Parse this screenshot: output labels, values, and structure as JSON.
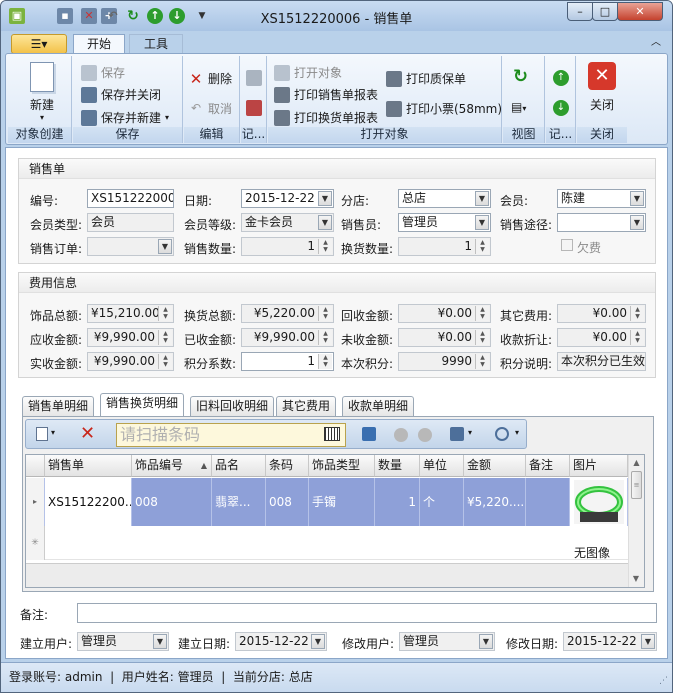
{
  "window": {
    "title": "XS1512220006 - 销售单",
    "minimize": "–",
    "maximize": "□",
    "close": "✕"
  },
  "ribbon": {
    "tabs": [
      "开始",
      "工具"
    ],
    "groups": {
      "object_create": {
        "label": "对象创建",
        "new": "新建"
      },
      "save": {
        "label": "保存",
        "save": "保存",
        "save_close": "保存并关闭",
        "save_new": "保存并新建"
      },
      "edit": {
        "label": "编辑",
        "delete": "删除",
        "cancel": "取消"
      },
      "record": {
        "label": "记..."
      },
      "open": {
        "label": "打开对象",
        "open_object": "打开对象",
        "print_sales_report": "打印销售单报表",
        "print_exchange_report": "打印换货单报表",
        "print_warranty": "打印质保单",
        "print_ticket": "打印小票(58mm)"
      },
      "view": {
        "label": "视图"
      },
      "record2": {
        "label": "记..."
      },
      "close": {
        "label": "关闭",
        "close": "关闭"
      }
    }
  },
  "sales_order": {
    "section_title": "销售单",
    "number_label": "编号:",
    "number_value": "XS1512220006",
    "date_label": "日期:",
    "date_value": "2015-12-22",
    "branch_label": "分店:",
    "branch_value": "总店",
    "member_label": "会员:",
    "member_value": "陈建",
    "member_type_label": "会员类型:",
    "member_type_value": "会员",
    "member_level_label": "会员等级:",
    "member_level_value": "金卡会员",
    "salesperson_label": "销售员:",
    "salesperson_value": "管理员",
    "channel_label": "销售途径:",
    "channel_value": "",
    "order_label": "销售订单:",
    "order_value": "",
    "sales_qty_label": "销售数量:",
    "sales_qty_value": "1",
    "exchange_qty_label": "换货数量:",
    "exchange_qty_value": "1",
    "owe_label": "欠费"
  },
  "fees": {
    "section_title": "费用信息",
    "jewelry_total_label": "饰品总额:",
    "jewelry_total_value": "¥15,210.00",
    "exchange_total_label": "换货总额:",
    "exchange_total_value": "¥5,220.00",
    "recycle_label": "回收金额:",
    "recycle_value": "¥0.00",
    "other_fee_label": "其它费用:",
    "other_fee_value": "¥0.00",
    "receivable_label": "应收金额:",
    "receivable_value": "¥9,990.00",
    "received_label": "已收金额:",
    "received_value": "¥9,990.00",
    "unreceived_label": "未收金额:",
    "unreceived_value": "¥0.00",
    "discount_label": "收款折让:",
    "discount_value": "¥0.00",
    "actual_label": "实收金额:",
    "actual_value": "¥9,990.00",
    "points_coef_label": "积分系数:",
    "points_coef_value": "1",
    "points_label": "本次积分:",
    "points_value": "9990",
    "points_note_label": "积分说明:",
    "points_note_value": "本次积分已生效"
  },
  "detail_tabs": [
    "销售单明细",
    "销售换货明细",
    "旧料回收明细",
    "其它费用",
    "收款单明细"
  ],
  "toolbar": {
    "scan_placeholder": "请扫描条码"
  },
  "grid": {
    "columns": [
      "销售单",
      "饰品编号",
      "品名",
      "条码",
      "饰品类型",
      "数量",
      "单位",
      "金额",
      "备注",
      "图片"
    ],
    "rows": [
      {
        "order": "XS15122200...",
        "item_no": "008",
        "name": "翡翠...",
        "barcode": "008",
        "type": "手镯",
        "qty": "1",
        "unit": "个",
        "amount": "¥5,220....",
        "note": "",
        "image": "jade-bracelet"
      }
    ],
    "no_image": "无图像"
  },
  "footer": {
    "remark_label": "备注:",
    "remark_value": "",
    "creator_label": "建立用户:",
    "creator_value": "管理员",
    "create_date_label": "建立日期:",
    "create_date_value": "2015-12-22",
    "modifier_label": "修改用户:",
    "modifier_value": "管理员",
    "modify_date_label": "修改日期:",
    "modify_date_value": "2015-12-22"
  },
  "status": {
    "text": "登录账号: admin  |  用户姓名: 管理员  |  当前分店: 总店"
  },
  "colors": {
    "selection": "#8ea0d8",
    "ribbon_bg": "#dce8f6",
    "close_red": "#d6382b"
  }
}
